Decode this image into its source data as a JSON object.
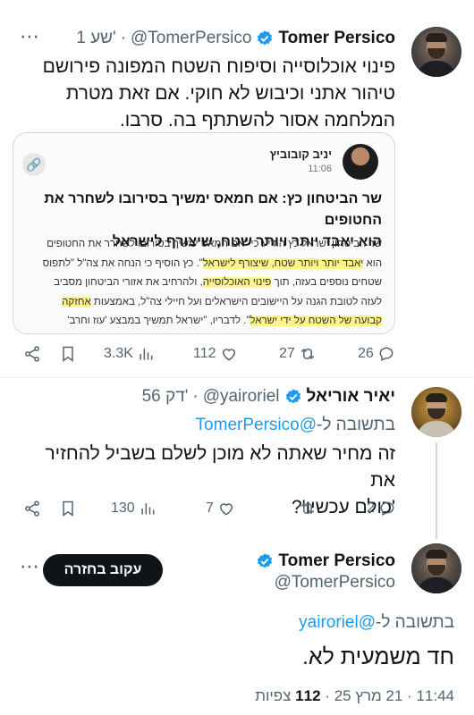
{
  "tweet1": {
    "name": "Tomer Persico",
    "handle": "@TomerPersico",
    "separator": "·",
    "time": "1 שע'",
    "more": "⋯",
    "text_lines": [
      "פינוי אוכלוסייה וסיפוח השטח המפונה פירושם",
      "טיהור אתני וכיבוש לא חוקי. אם זאת מטרת",
      "המלחמה אסור להשתתף בה. סרבו."
    ],
    "card": {
      "author": "יניב קובוביץ",
      "time": "11:06",
      "headline_lines": [
        "שר הביטחון כץ: אם חמאס ימשיך בסירובו לשחרר את החטופים",
        "הוא יאבד יותר ויותר שטח, שיצורף לישראל"
      ],
      "body_lines": [
        {
          "before": "שר הביטחון ישראל כץ הודיע כי \"אם חמאס ימשיך בסירובו לשחרר את החטופים",
          "mark": "",
          "after": ""
        },
        {
          "before": "הוא ",
          "mark": "יאבד יותר ויותר שטח, שיצורף לישראל",
          "after": "\". כץ הוסיף כי הנחה את צה\"ל \"לתפוס"
        },
        {
          "before": "שטחים נוספים בעזה, תוך ",
          "mark": "פינוי האוכלוסייה",
          "after": ", ולהרחיב את אזורי הביטחון מסביב"
        },
        {
          "before": "לעזה לטובת הגנה על היישובים הישראלים ועל חיילי צה\"ל, באמצעות ",
          "mark": "אחזקה",
          "after": ""
        },
        {
          "before": "",
          "mark": "קבועה של השטח על ידי ישראל",
          "after": "\". לדבריו, \"ישראל תמשיך במבצע 'עוז וחרב'"
        }
      ]
    },
    "stats": {
      "views": "3.3K",
      "likes": "112",
      "retweets": "27",
      "replies": "26"
    }
  },
  "tweet2": {
    "name": "יאיר אוריאל",
    "handle": "@yairoriel",
    "separator": "·",
    "time": "56 דק'",
    "reply_prefix": "בתשובה ל-",
    "reply_to": "@TomerPersico",
    "text_lines": [
      "זה מחיר שאתה לא מוכן לשלם בשביל להחזיר את",
      "'כולם עכשיו'?"
    ],
    "stats": {
      "views": "130",
      "likes": "7",
      "retweets": "",
      "replies": "2"
    }
  },
  "tweet3": {
    "name": "Tomer Persico",
    "handle": "@TomerPersico",
    "follow_button": "עקוב בחזרה",
    "reply_prefix": "בתשובה ל-",
    "reply_to": "@yairoriel",
    "text": "חד משמעית לא.",
    "meta_time": "11:44",
    "meta_date": "21 מרץ 25",
    "meta_views": "112",
    "meta_views_label": "צפיות",
    "separator": "·"
  },
  "colors": {
    "accent": "#1d9bf0",
    "text": "#0f1419",
    "muted": "#536471",
    "highlight": "#fff38a"
  }
}
